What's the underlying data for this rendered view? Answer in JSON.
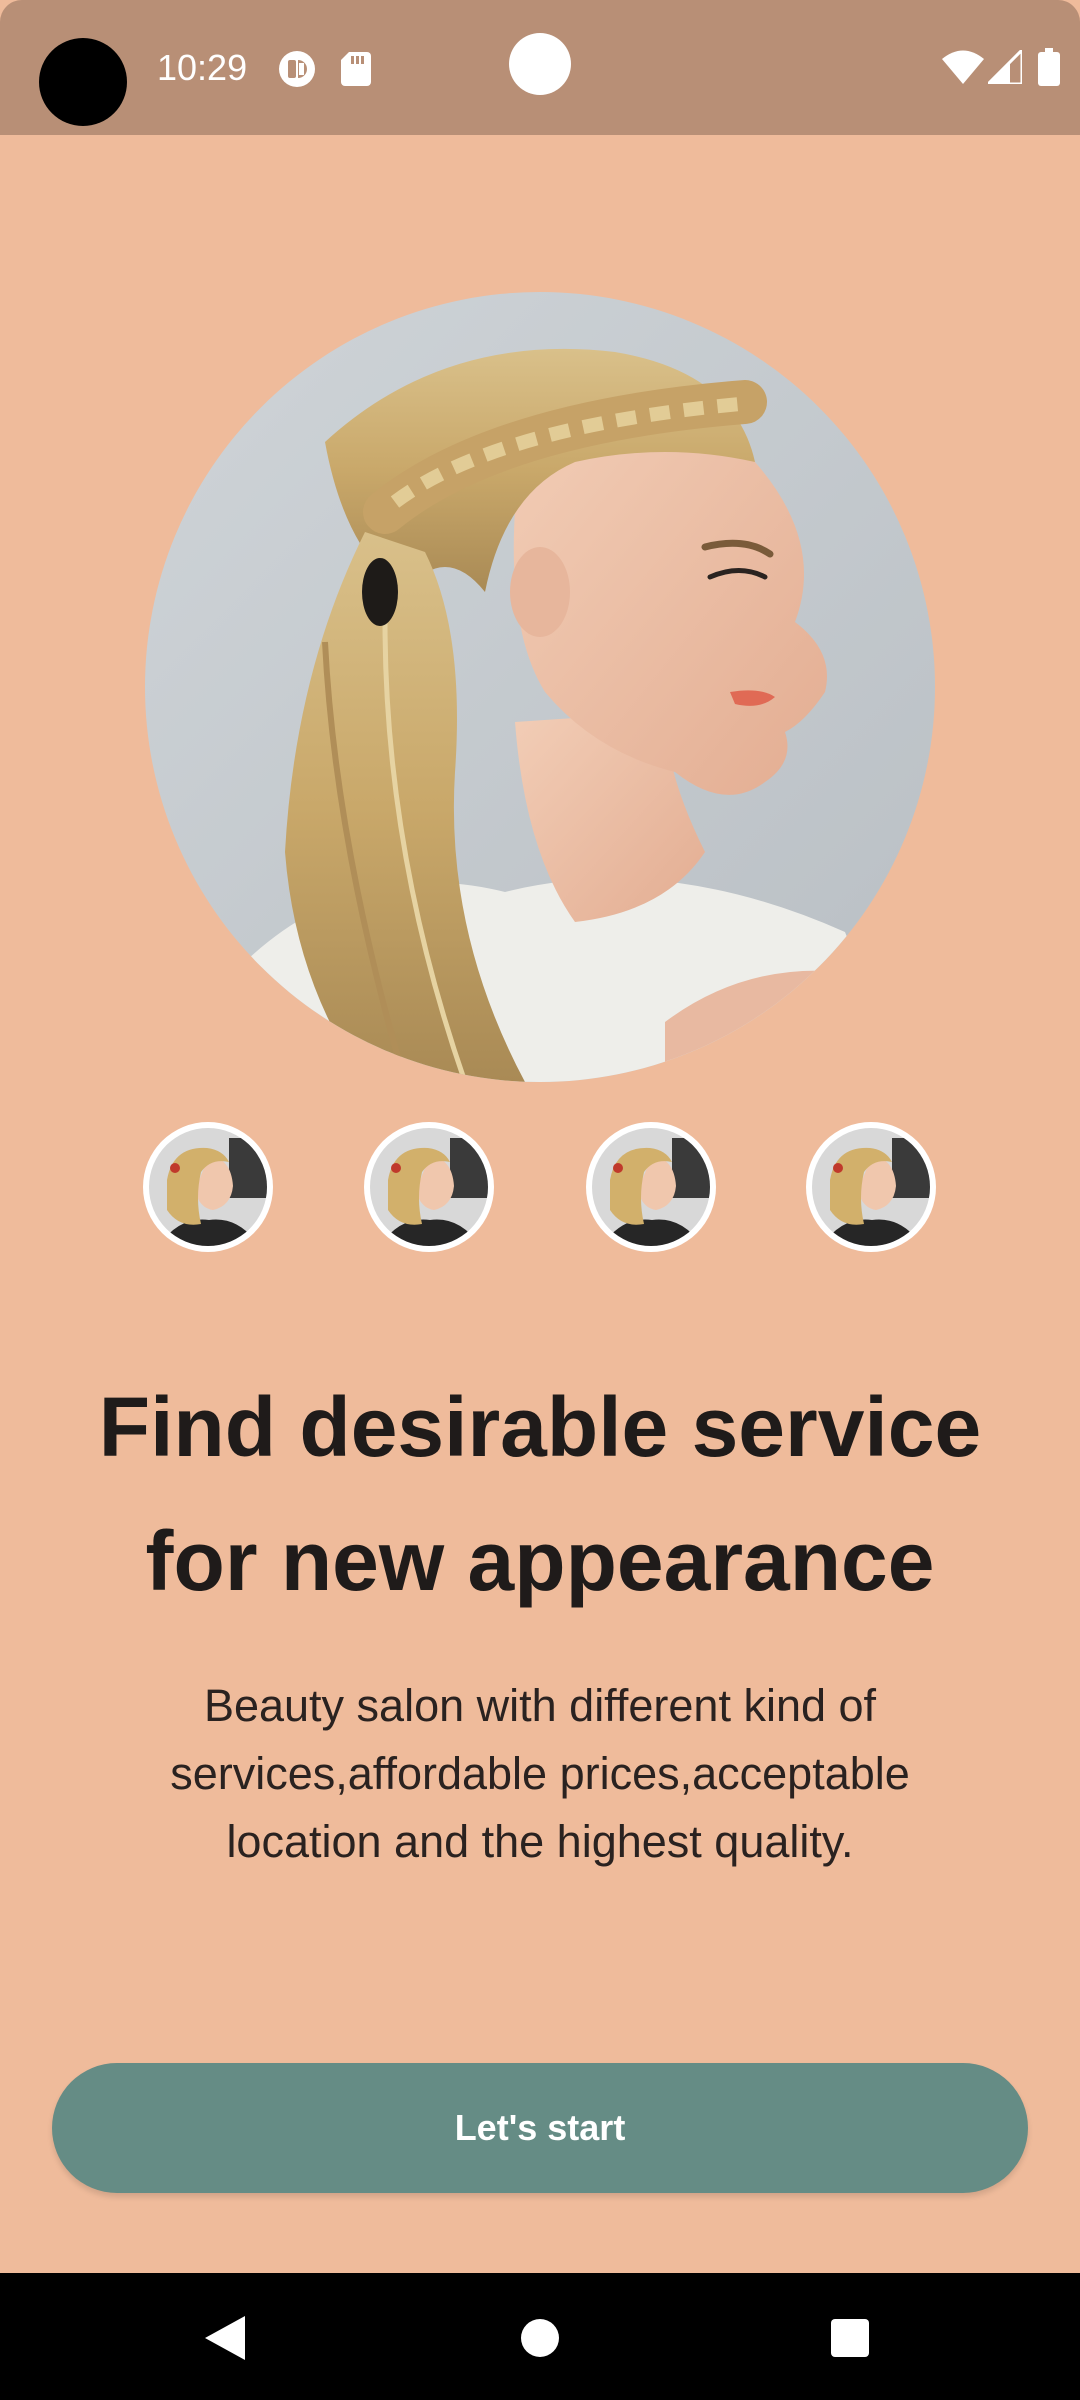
{
  "status_bar": {
    "time": "10:29",
    "icons": [
      "camera-cutout",
      "g-assistant-icon",
      "sd-card-icon",
      "front-camera",
      "wifi-icon",
      "cell-signal-icon",
      "battery-icon"
    ]
  },
  "hero": {
    "image": "woman-braided-ponytail-photo"
  },
  "thumbnails": [
    {
      "image": "woman-hairstyle-thumbnail"
    },
    {
      "image": "woman-hairstyle-thumbnail"
    },
    {
      "image": "woman-hairstyle-thumbnail"
    },
    {
      "image": "woman-hairstyle-thumbnail"
    }
  ],
  "content": {
    "headline_line1": "Find desirable service",
    "headline_line2": "for new appearance",
    "description_line1": "Beauty salon with different kind of",
    "description_line2": "services,affordable prices,acceptable",
    "description_line3": "location and the highest quality."
  },
  "cta": {
    "label": "Let's start"
  },
  "nav_bar": {
    "icons": [
      "back-icon",
      "home-icon",
      "recents-icon"
    ]
  },
  "colors": {
    "background": "#efbb9b",
    "status_bar": "#b88f76",
    "button": "#658c85",
    "text": "#1f1b1a"
  }
}
